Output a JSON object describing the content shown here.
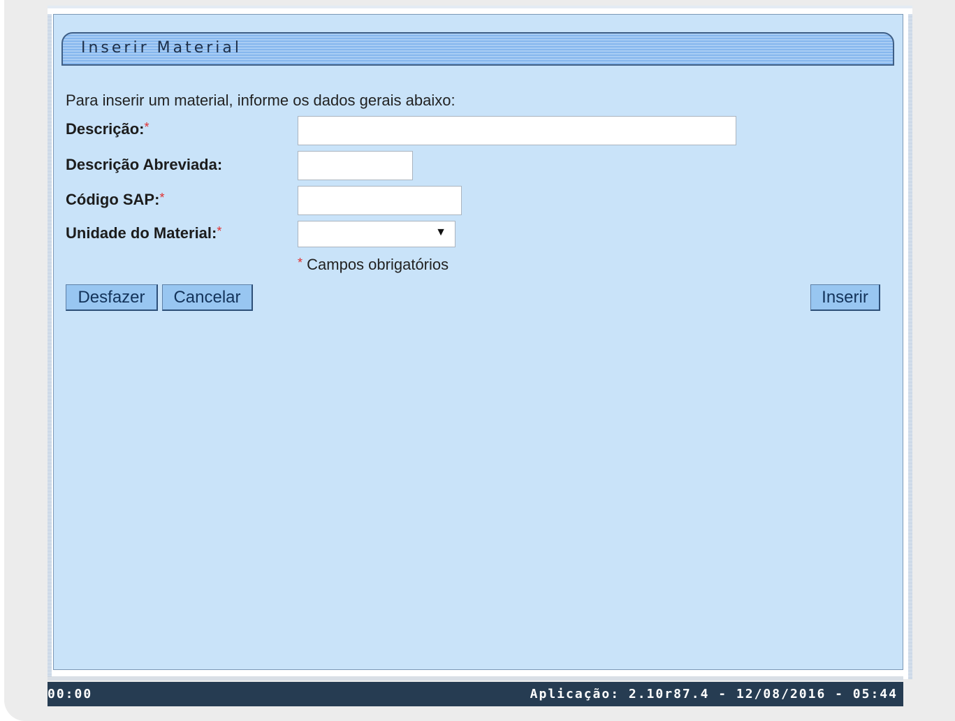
{
  "form": {
    "title": "Inserir Material",
    "intro": "Para inserir um material, informe os dados gerais abaixo:",
    "fields": {
      "descricao": {
        "label": "Descrição:",
        "required_mark": "*",
        "value": ""
      },
      "descricao_abreviada": {
        "label": "Descrição Abreviada:",
        "value": ""
      },
      "codigo_sap": {
        "label": "Código SAP:",
        "required_mark": "*",
        "value": ""
      },
      "unidade": {
        "label": "Unidade do Material:",
        "required_mark": "*",
        "selected": ""
      }
    },
    "required_note_mark": "*",
    "required_note": "Campos obrigatórios",
    "buttons": {
      "undo": "Desfazer",
      "cancel": "Cancelar",
      "insert": "Inserir"
    }
  },
  "status_bar": {
    "left": "00:00",
    "right": "Aplicação: 2.10r87.4 - 12/08/2016 - 05:44"
  },
  "colors": {
    "panel_bg": "#c9e3f9",
    "title_stripe": "#86b7ee",
    "button_bg": "#98c6f1",
    "status_bg": "#263c52",
    "required": "#e03030"
  }
}
